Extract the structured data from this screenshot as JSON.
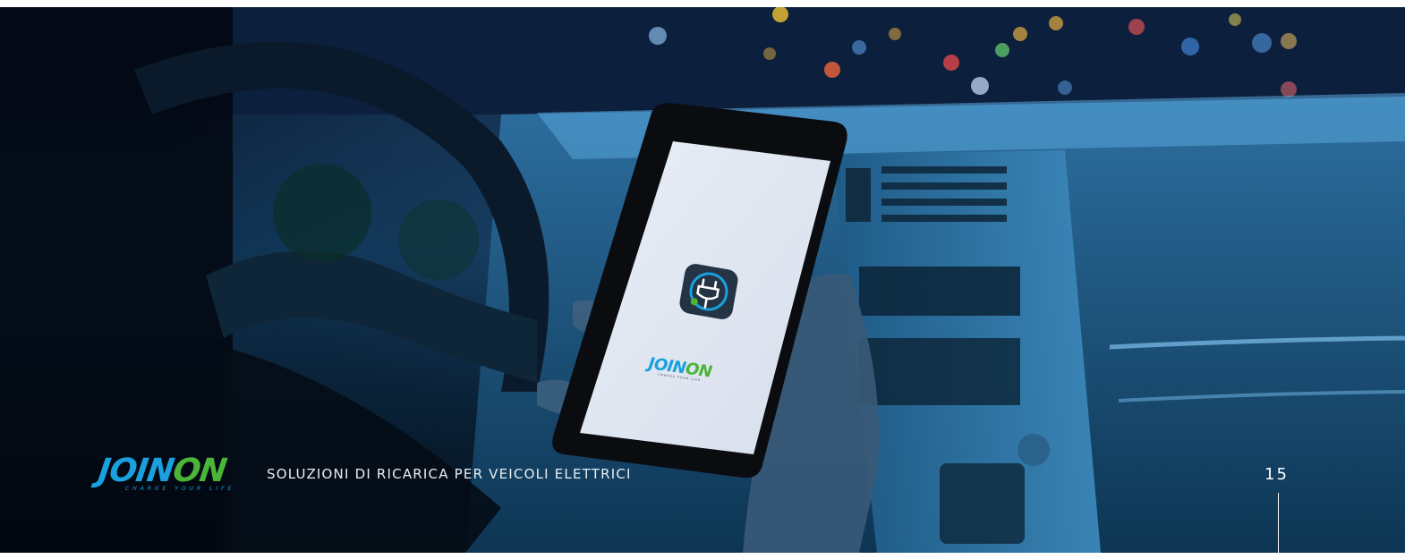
{
  "brand": {
    "logo_text_blue": "JOIN",
    "logo_text_green": "ON",
    "tagline": "CHARGE YOUR LIFE",
    "blue": "#1aa0df",
    "green": "#4bb53a"
  },
  "footer": {
    "title": "SOLUZIONI DI RICARICA PER VEICOLI ELETTRICI",
    "page_number": "15"
  },
  "phone_screen": {
    "app_icon": "plug-charging-icon",
    "logo_text_blue": "JOIN",
    "logo_text_green": "ON",
    "tagline": "CHARGE YOUR LIFE"
  }
}
